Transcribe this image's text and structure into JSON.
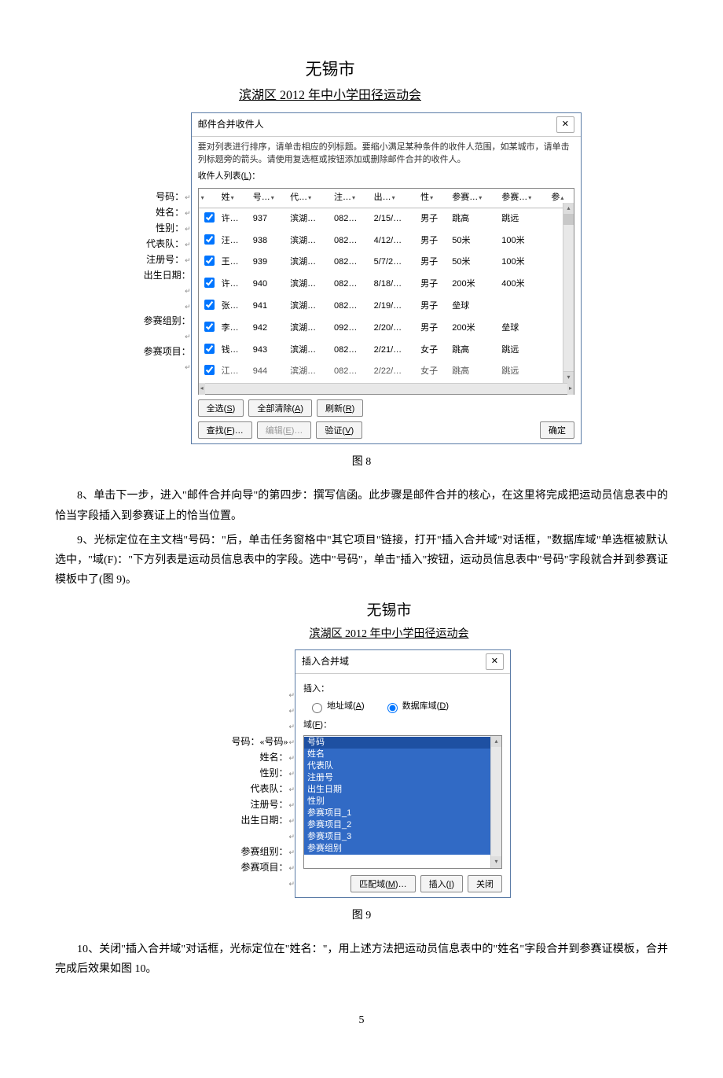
{
  "fig8": {
    "title_city": "无锡市",
    "title_line": "滨湖区 2012 年中小学田径运动会",
    "labels": [
      "号码：",
      "姓名：",
      "性别：",
      "代表队：",
      "注册号：",
      "出生日期："
    ],
    "labels_group2": [
      "参赛组别：",
      "参赛项目："
    ],
    "dialog": {
      "title": "邮件合并收件人",
      "hint": "要对列表进行排序，请单击相应的列标题。要缩小满足某种条件的收件人范围，如某城市，请单击列标题旁的箭头。请使用复选框或按钮添加或删除邮件合并的收件人。",
      "list_label": "收件人列表(L)：",
      "headers": [
        "",
        "",
        "号…",
        "代…",
        "注…",
        "出…",
        "性…",
        "参赛…",
        "参赛…",
        "参…"
      ],
      "rows": [
        {
          "cb": true,
          "c": [
            "许…",
            "937",
            "滨湖…",
            "082…",
            "2/15/…",
            "男子",
            "跳高",
            "跳远",
            ""
          ]
        },
        {
          "cb": true,
          "c": [
            "汪…",
            "938",
            "滨湖…",
            "082…",
            "4/12/…",
            "男子",
            "50米",
            "100米",
            ""
          ]
        },
        {
          "cb": true,
          "c": [
            "王…",
            "939",
            "滨湖…",
            "082…",
            "5/7/2…",
            "男子",
            "50米",
            "100米",
            ""
          ]
        },
        {
          "cb": true,
          "c": [
            "许…",
            "940",
            "滨湖…",
            "082…",
            "8/18/…",
            "男子",
            "200米",
            "400米",
            ""
          ]
        },
        {
          "cb": true,
          "c": [
            "张…",
            "941",
            "滨湖…",
            "082…",
            "2/19/…",
            "男子",
            "垒球",
            "",
            ""
          ]
        },
        {
          "cb": true,
          "c": [
            "李…",
            "942",
            "滨湖…",
            "092…",
            "2/20/…",
            "男子",
            "200米",
            "垒球",
            ""
          ]
        },
        {
          "cb": true,
          "c": [
            "钱…",
            "943",
            "滨湖…",
            "082…",
            "2/21/…",
            "女子",
            "跳高",
            "跳远",
            ""
          ]
        },
        {
          "cb": true,
          "c": [
            "江…",
            "944",
            "滨湖…",
            "082…",
            "2/22/…",
            "女子",
            "跳高",
            "跳远",
            ""
          ],
          "partial": true
        }
      ],
      "buttons": {
        "select_all": "全选(S)",
        "clear_all": "全部清除(A)",
        "refresh": "刷新(R)",
        "find": "查找(F)…",
        "edit": "编辑(E)…",
        "validate": "验证(V)",
        "ok": "确定"
      }
    },
    "caption": "图 8"
  },
  "para8": "8、单击下一步，进入\"邮件合并向导\"的第四步：撰写信函。此步骤是邮件合并的核心，在这里将完成把运动员信息表中的恰当字段插入到参赛证上的恰当位置。",
  "para9a": "9、光标定位在主文档\"号码：\"后，单击任务窗格中\"其它项目\"链接，打开\"插入合并域\"对话框，\"数据库域\"单选框被默认选中，\"域(F)：\"下方列表是运动员信息表中的字段。选中\"号码\"，单击\"插入\"按钮，运动员信息表中\"号码\"字段就合并到参赛证模板中了(图 9)。",
  "fig9": {
    "title_city": "无锡市",
    "title_line": "滨湖区 2012 年中小学田径运动会",
    "label_first": "号码：«号码»",
    "labels_rest": [
      "姓名：",
      "性别：",
      "代表队：",
      "注册号：",
      "出生日期："
    ],
    "labels_group2": [
      "参赛组别：",
      "参赛项目："
    ],
    "dialog": {
      "title": "插入合并域",
      "insert_label": "插入：",
      "radio_address": "地址域(A)",
      "radio_db": "数据库域(D)",
      "fields_label": "域(F)：",
      "items": [
        "号码",
        "姓名",
        "代表队",
        "注册号",
        "出生日期",
        "性别",
        "参赛项目_1",
        "参赛项目_2",
        "参赛项目_3",
        "参赛组别"
      ],
      "buttons": {
        "match": "匹配域(M)…",
        "insert": "插入(I)",
        "close": "关闭"
      }
    },
    "caption": "图 9"
  },
  "para10": "10、关闭\"插入合并域\"对话框，光标定位在\"姓名：\"，用上述方法把运动员信息表中的\"姓名\"字段合并到参赛证模板，合并完成后效果如图 10。",
  "page_number": "5"
}
